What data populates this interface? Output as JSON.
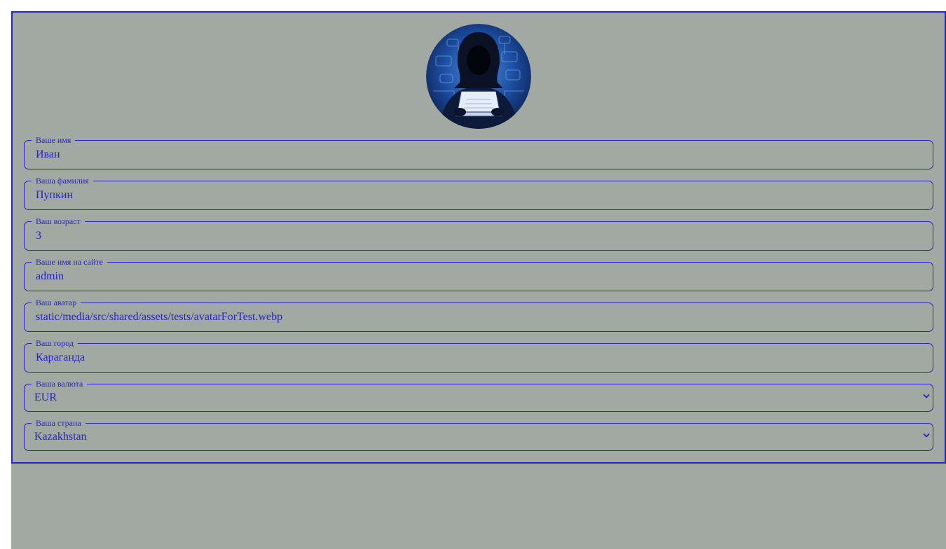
{
  "profile": {
    "fields": [
      {
        "label": "Ваше имя",
        "value": "Иван"
      },
      {
        "label": "Ваша фамилия",
        "value": "Пупкин"
      },
      {
        "label": "Ваш возраст",
        "value": "3"
      },
      {
        "label": "Ваше имя на сайте",
        "value": "admin"
      },
      {
        "label": "Ваш аватар",
        "value": "static/media/src/shared/assets/tests/avatarForTest.webp"
      },
      {
        "label": "Ваш город",
        "value": "Караганда"
      }
    ],
    "currency": {
      "label": "Ваша валюта",
      "value": "EUR"
    },
    "country": {
      "label": "Ваша страна",
      "value": "Kazakhstan"
    }
  },
  "colors": {
    "accent": "#2424c8",
    "background": "#a2a8a2"
  },
  "icons": {
    "avatar": "hooded-hacker-avatar",
    "select_arrow": "chevron-down-icon"
  }
}
